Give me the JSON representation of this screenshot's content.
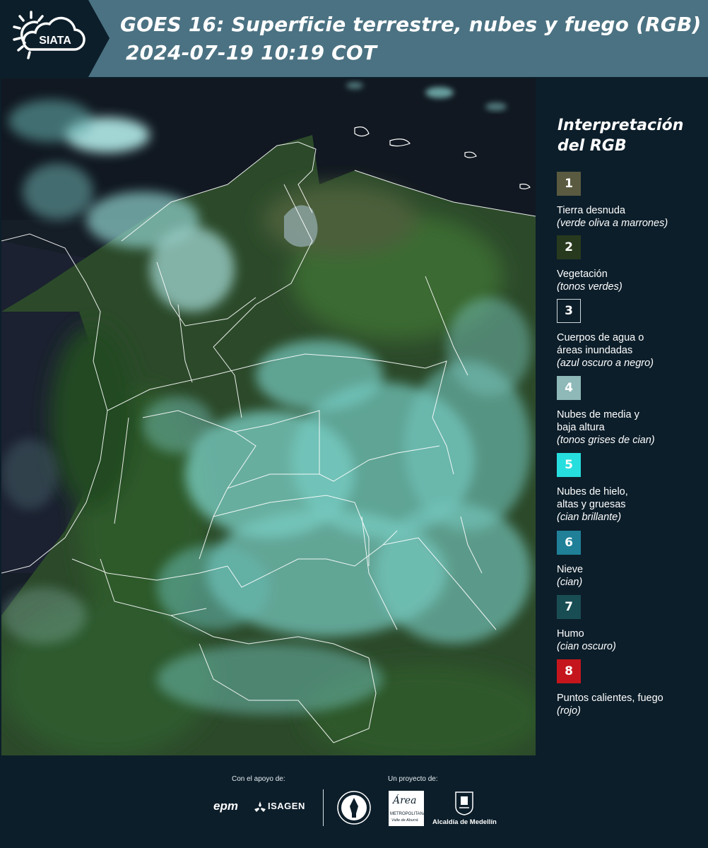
{
  "header": {
    "logo_text": "SIATA",
    "title": "GOES 16: Superficie terrestre, nubes y fuego (RGB)",
    "timestamp": "2024-07-19 10:19 COT"
  },
  "legend": {
    "title_line1": "Interpretación",
    "title_line2": "del RGB",
    "items": [
      {
        "number": "1",
        "color": "#5a5a40",
        "name_lines": [
          "Tierra desnuda"
        ],
        "note": "(verde oliva a marrones)"
      },
      {
        "number": "2",
        "color": "#283a1d",
        "name_lines": [
          "Vegetación"
        ],
        "note": "(tonos verdes)"
      },
      {
        "number": "3",
        "color": "#0c1e2a",
        "name_lines": [
          "Cuerpos de agua o",
          "áreas inundadas"
        ],
        "note": "(azul oscuro a negro)"
      },
      {
        "number": "4",
        "color": "#8fb8b8",
        "name_lines": [
          "Nubes de media y",
          "baja altura"
        ],
        "note": "(tonos grises de cian)"
      },
      {
        "number": "5",
        "color": "#27dede",
        "name_lines": [
          "Nubes de hielo,",
          "altas y gruesas"
        ],
        "note": "(cian brillante)"
      },
      {
        "number": "6",
        "color": "#1f8098",
        "name_lines": [
          "Nieve"
        ],
        "note": "(cian)"
      },
      {
        "number": "7",
        "color": "#194d54",
        "name_lines": [
          "Humo"
        ],
        "note": "(cian oscuro)"
      },
      {
        "number": "8",
        "color": "#c4161c",
        "name_lines": [
          "Puntos calientes, fuego"
        ],
        "note": "(rojo)"
      }
    ]
  },
  "footer": {
    "support_label": "Con el apoyo de:",
    "project_label": "Un proyecto de:",
    "sponsors": [
      "epm",
      "ISAGEN"
    ],
    "partners": {
      "area_name": "Área",
      "area_sub1": "METROPOLITANA",
      "area_sub2": "Valle de Aburrá",
      "alcaldia": "Alcaldía de Medellín"
    }
  },
  "colors": {
    "header_bg": "#4b7282",
    "panel_bg": "#0c1e2a",
    "vegetation": "#284a24",
    "cloud_cyan": "#7fe0da",
    "ocean": "#18202c"
  }
}
